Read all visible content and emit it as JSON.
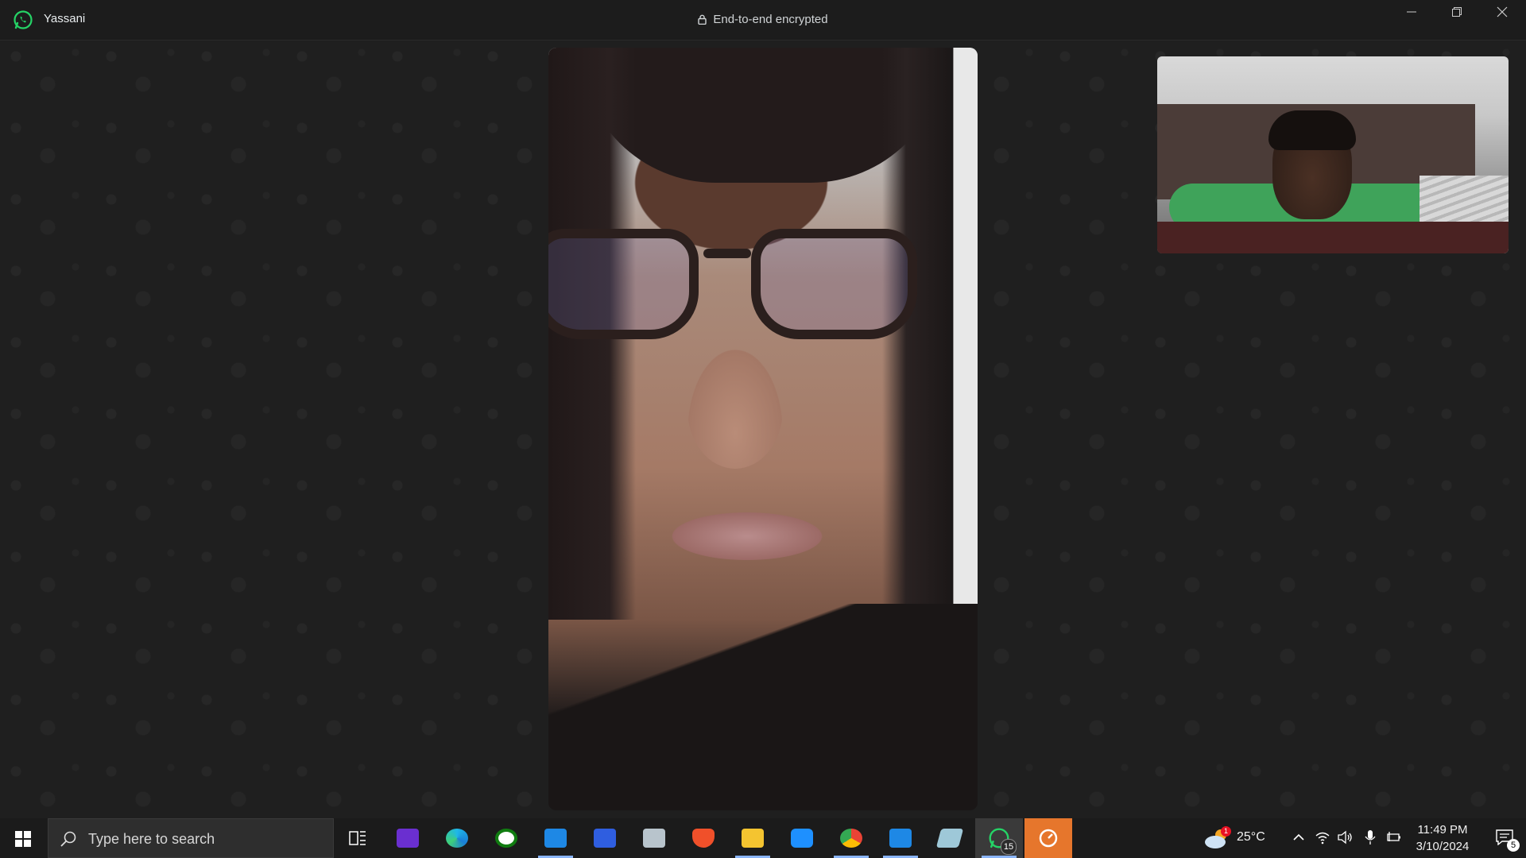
{
  "titlebar": {
    "contact_name": "Yassani",
    "encryption_label": "End-to-end encrypted"
  },
  "window_controls": {
    "minimize": "minimize-icon",
    "restore": "restore-icon",
    "close": "close-icon"
  },
  "colors": {
    "whatsapp_green": "#25d366",
    "background": "#1f1f1f",
    "taskbar": "#1b1b1b"
  },
  "taskbar": {
    "search_placeholder": "Type here to search",
    "apps": [
      "task-view-icon",
      "video-editor-icon",
      "edge-icon",
      "xbox-icon",
      "mail-icon",
      "sketch-app-icon",
      "photos-icon",
      "brave-icon",
      "file-explorer-icon",
      "vpn-icon",
      "chrome-icon",
      "calendar-icon",
      "notes-app-icon",
      "whatsapp-icon",
      "timer-app-icon"
    ],
    "whatsapp_badge": "15",
    "weather_temp": "25°C",
    "weather_alert": "1",
    "time": "11:49 PM",
    "date": "3/10/2024",
    "notifications_badge": "5"
  }
}
